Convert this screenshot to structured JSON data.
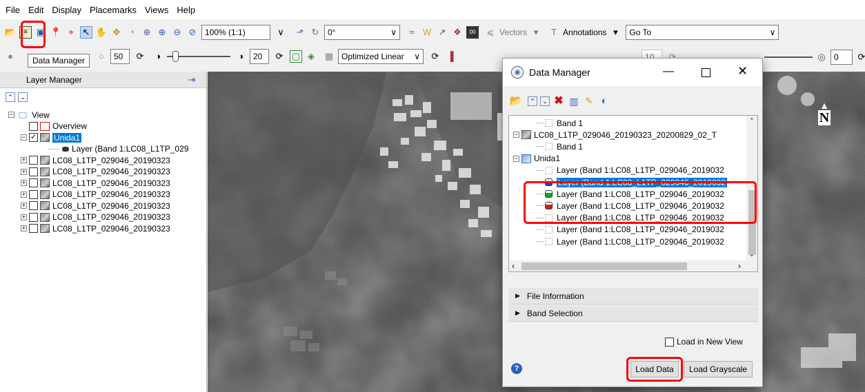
{
  "menu": [
    "File",
    "Edit",
    "Display",
    "Placemarks",
    "Views",
    "Help"
  ],
  "toolbar1": {
    "zoom_value": "100% (1:1)",
    "rotation_value": "0°",
    "vectors_label": "Vectors",
    "annotations_label": "Annotations",
    "goto_value": "Go To"
  },
  "toolbar2": {
    "tooltip": "Data Manager",
    "brightness_value": "50",
    "contrast_value": "20",
    "stretch_value": "Optimized Linear",
    "sharpen_value": "10",
    "transparency_value": "0"
  },
  "layer_manager": {
    "title": "Layer Manager",
    "tree": [
      {
        "label": "View",
        "depth": 0
      },
      {
        "label": "Overview",
        "depth": 1
      },
      {
        "label": "Unida1",
        "depth": 1,
        "checked": true,
        "selected": true
      },
      {
        "label": "Layer (Band 1:LC08_L1TP_029",
        "depth": 2
      },
      {
        "label": "LC08_L1TP_029046_20190323",
        "depth": 1
      },
      {
        "label": "LC08_L1TP_029046_20190323",
        "depth": 1
      },
      {
        "label": "LC08_L1TP_029046_20190323",
        "depth": 1
      },
      {
        "label": "LC08_L1TP_029046_20190323",
        "depth": 1
      },
      {
        "label": "LC08_L1TP_029046_20190323",
        "depth": 1
      },
      {
        "label": "LC08_L1TP_029046_20190323",
        "depth": 1
      },
      {
        "label": "LC08_L1TP_029046_20190323",
        "depth": 1
      }
    ]
  },
  "north_arrow": "N",
  "data_manager": {
    "title": "Data Manager",
    "tree": [
      {
        "label": "Band 1",
        "depth": 2,
        "kind": "band"
      },
      {
        "label": "LC08_L1TP_029046_20190323_20200829_02_T",
        "depth": 1,
        "kind": "file"
      },
      {
        "label": "Band 1",
        "depth": 2,
        "kind": "band"
      },
      {
        "label": "Unida1",
        "depth": 1,
        "kind": "group"
      },
      {
        "label": "Layer (Band 1:LC08_L1TP_029046_2019032",
        "depth": 2,
        "kind": "band"
      },
      {
        "label": "Layer (Band 1:LC08_L1TP_029046_2019032",
        "depth": 2,
        "kind": "blue",
        "selected": true
      },
      {
        "label": "Layer (Band 1:LC08_L1TP_029046_2019032",
        "depth": 2,
        "kind": "green"
      },
      {
        "label": "Layer (Band 1:LC08_L1TP_029046_2019032",
        "depth": 2,
        "kind": "red"
      },
      {
        "label": "Layer (Band 1:LC08_L1TP_029046_2019032",
        "depth": 2,
        "kind": "band"
      },
      {
        "label": "Layer (Band 1:LC08_L1TP_029046_2019032",
        "depth": 2,
        "kind": "band"
      },
      {
        "label": "Layer (Band 1:LC08_L1TP_029046_2019032",
        "depth": 2,
        "kind": "band"
      }
    ],
    "file_information": "File Information",
    "band_selection": "Band Selection",
    "load_new_view": "Load in New View",
    "load_data": "Load Data",
    "load_grayscale": "Load Grayscale",
    "colors": {
      "blue": "#2a35e0",
      "green": "#16a51f",
      "red": "#e0141b",
      "selection": "#0078d7",
      "highlight": "#ff0000"
    }
  }
}
